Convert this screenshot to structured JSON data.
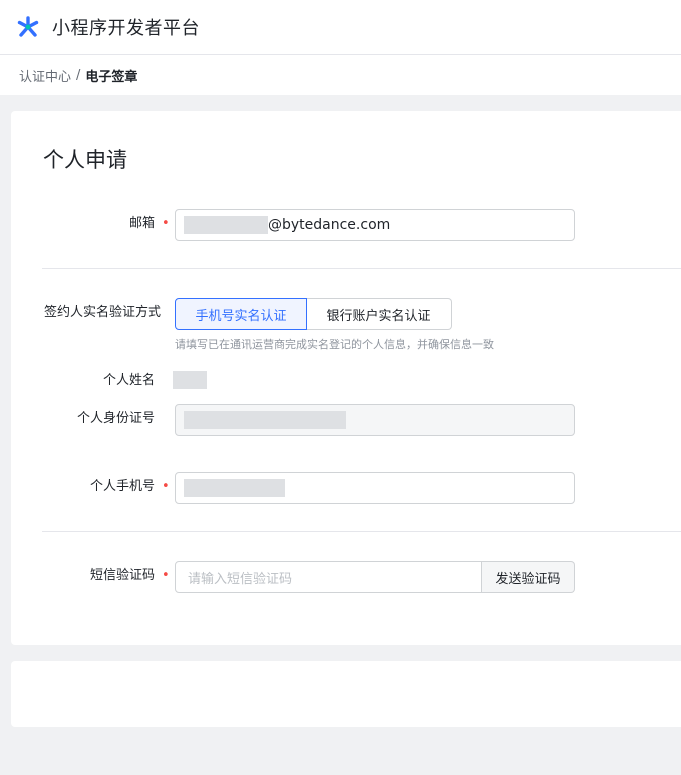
{
  "header": {
    "app_title": "小程序开发者平台",
    "logo_icon": "asterisk-logo-icon",
    "brand_color": "#3370ff"
  },
  "breadcrumb": {
    "parent": "认证中心",
    "separator": "/",
    "current": "电子签章"
  },
  "form": {
    "title": "个人申请",
    "required_mark": "•",
    "email": {
      "label": "邮箱",
      "suffix": "@bytedance.com"
    },
    "verify_method": {
      "label": "签约人实名验证方式",
      "options": [
        "手机号实名认证",
        "银行账户实名认证"
      ],
      "selected": "手机号实名认证",
      "hint": "请填写已在通讯运营商完成实名登记的个人信息，并确保信息一致"
    },
    "name": {
      "label": "个人姓名"
    },
    "id_number": {
      "label": "个人身份证号"
    },
    "phone": {
      "label": "个人手机号"
    },
    "sms_code": {
      "label": "短信验证码",
      "placeholder": "请输入短信验证码",
      "send_button": "发送验证码"
    }
  },
  "colors": {
    "required": "#f54a45",
    "active_border": "#3370ff",
    "page_bg": "#f0f1f3"
  }
}
